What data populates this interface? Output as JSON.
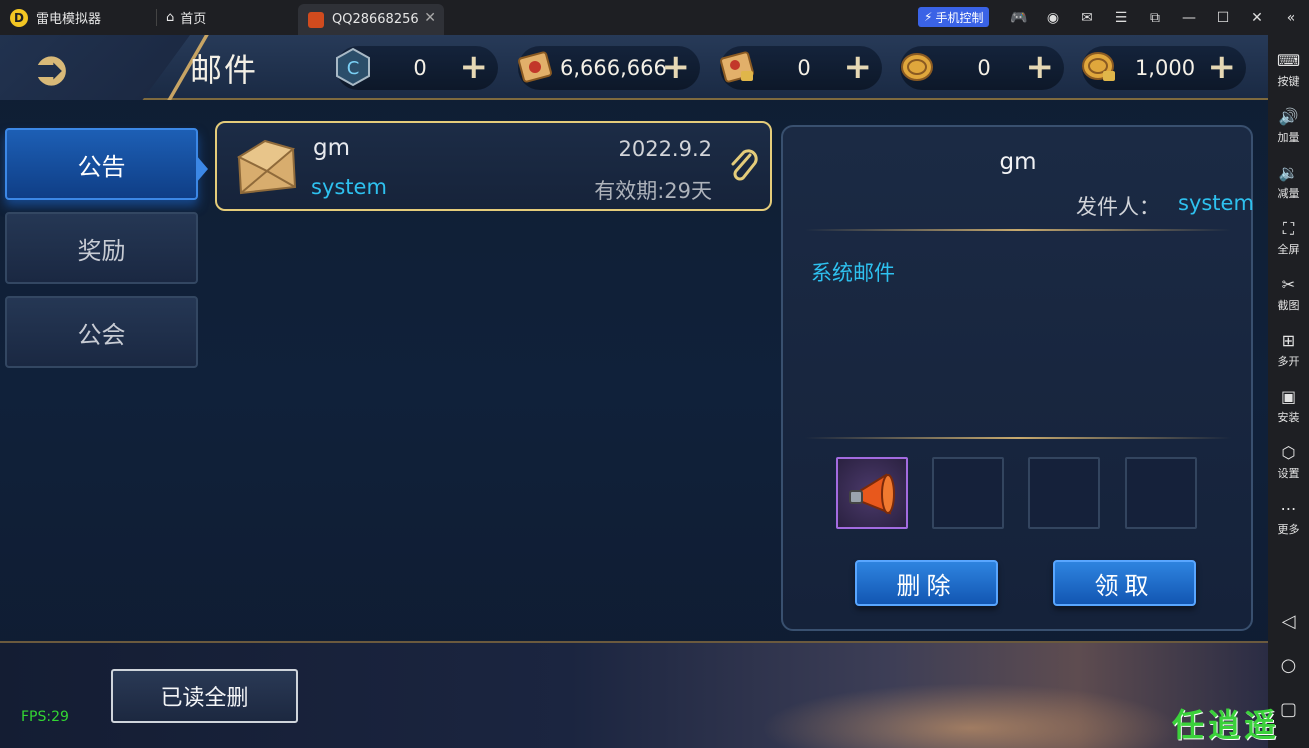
{
  "titlebar": {
    "app_name": "雷电模拟器",
    "home_tab": "首页",
    "game_tab": "QQ28668256",
    "phone_control": "手机控制"
  },
  "header": {
    "title": "邮件",
    "resources": [
      {
        "icon": "crest-icon",
        "value": "0"
      },
      {
        "icon": "scroll-icon",
        "value": "6,666,666"
      },
      {
        "icon": "locked-scroll-icon",
        "value": "0"
      },
      {
        "icon": "coin-icon",
        "value": "0"
      },
      {
        "icon": "locked-coin-icon",
        "value": "1,000"
      }
    ]
  },
  "tabs": [
    {
      "label": "公告",
      "active": true
    },
    {
      "label": "奖励",
      "active": false
    },
    {
      "label": "公会",
      "active": false
    }
  ],
  "mail_list": [
    {
      "title": "gm",
      "sender": "system",
      "date": "2022.9.2",
      "expiry": "有效期:29天",
      "has_attachment": true
    }
  ],
  "detail": {
    "title": "gm",
    "sender_label": "发件人：",
    "sender": "system",
    "body": "系统邮件",
    "attachments": [
      "horn-item-icon",
      "",
      "",
      ""
    ],
    "delete_button": "删除",
    "claim_button": "领取"
  },
  "footer": {
    "delete_all_read": "已读全删",
    "fps": "FPS:29"
  },
  "sidebar": [
    {
      "icon": "keyboard-icon",
      "label": "按键"
    },
    {
      "icon": "volume-up-icon",
      "label": "加量"
    },
    {
      "icon": "volume-down-icon",
      "label": "减量"
    },
    {
      "icon": "fullscreen-icon",
      "label": "全屏"
    },
    {
      "icon": "scissors-icon",
      "label": "截图"
    },
    {
      "icon": "multi-instance-icon",
      "label": "多开"
    },
    {
      "icon": "apk-icon",
      "label": "安装"
    },
    {
      "icon": "settings-icon",
      "label": "设置"
    },
    {
      "icon": "more-icon",
      "label": "更多"
    }
  ],
  "watermark": "任逍遥"
}
